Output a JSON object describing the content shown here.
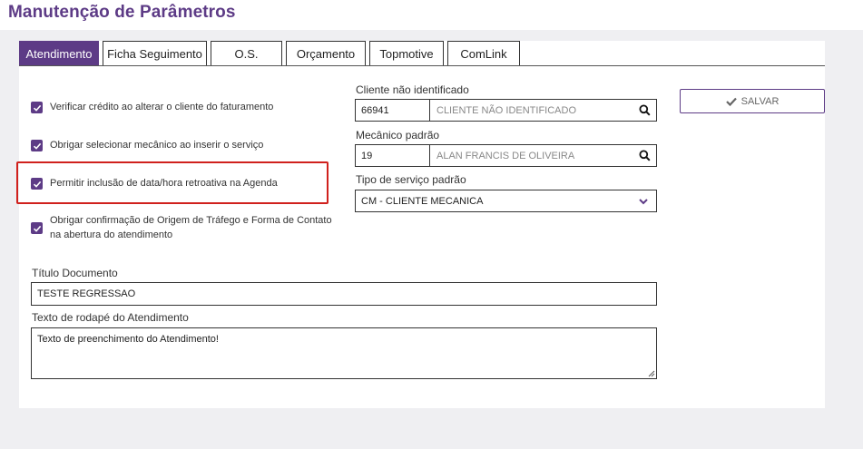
{
  "page": {
    "title": "Manutenção de Parâmetros"
  },
  "tabs": [
    {
      "label": "Atendimento",
      "active": true
    },
    {
      "label": "Ficha Seguimento",
      "active": false
    },
    {
      "label": "O.S.",
      "active": false
    },
    {
      "label": "Orçamento",
      "active": false
    },
    {
      "label": "Topmotive",
      "active": false
    },
    {
      "label": "ComLink",
      "active": false
    }
  ],
  "checkboxes": [
    {
      "label": "Verificar crédito ao alterar o cliente do faturamento",
      "checked": true
    },
    {
      "label": "Obrigar selecionar mecânico ao inserir o serviço",
      "checked": true
    },
    {
      "label": "Permitir inclusão de data/hora retroativa na Agenda",
      "checked": true
    },
    {
      "label_line1": "Obrigar confirmação de Origem de Tráfego e Forma de Contato",
      "label_line2": "na abertura do atendimento",
      "checked": true
    }
  ],
  "cliente": {
    "label": "Cliente não identificado",
    "code": "66941",
    "name": "CLIENTE NÃO IDENTIFICADO"
  },
  "mecanico": {
    "label": "Mecânico padrão",
    "code": "19",
    "name": "ALAN FRANCIS DE OLIVEIRA"
  },
  "tipo_servico": {
    "label": "Tipo de serviço padrão",
    "value": "CM - CLIENTE MECANICA"
  },
  "save": {
    "label": "SALVAR"
  },
  "titulo_documento": {
    "label": "Título Documento",
    "value": "TESTE REGRESSAO"
  },
  "rodape": {
    "label": "Texto de rodapé do Atendimento",
    "value": "Texto de preenchimento do Atendimento!"
  },
  "colors": {
    "accent": "#5d3b86",
    "highlight": "#d0211d"
  },
  "icons": {
    "search": "search-icon",
    "chevron": "chevron-down-icon",
    "check": "check-icon",
    "save": "checkmark-icon"
  }
}
